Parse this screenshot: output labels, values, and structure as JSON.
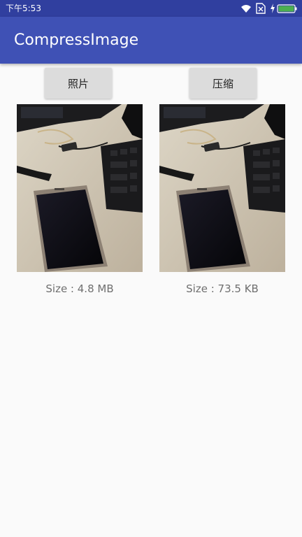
{
  "status_bar": {
    "time": "下午5:53",
    "icons": [
      "wifi-icon",
      "no-sim-icon",
      "charging-icon",
      "battery-icon"
    ],
    "battery_color": "#4caf50"
  },
  "app_bar": {
    "title": "CompressImage",
    "color": "#3f51b5"
  },
  "buttons": {
    "photo": "照片",
    "compress": "压缩"
  },
  "images": [
    {
      "description_icon": "photo-original",
      "size_text": "Size : 4.8 MB"
    },
    {
      "description_icon": "photo-compressed",
      "size_text": "Size : 73.5 KB"
    }
  ]
}
